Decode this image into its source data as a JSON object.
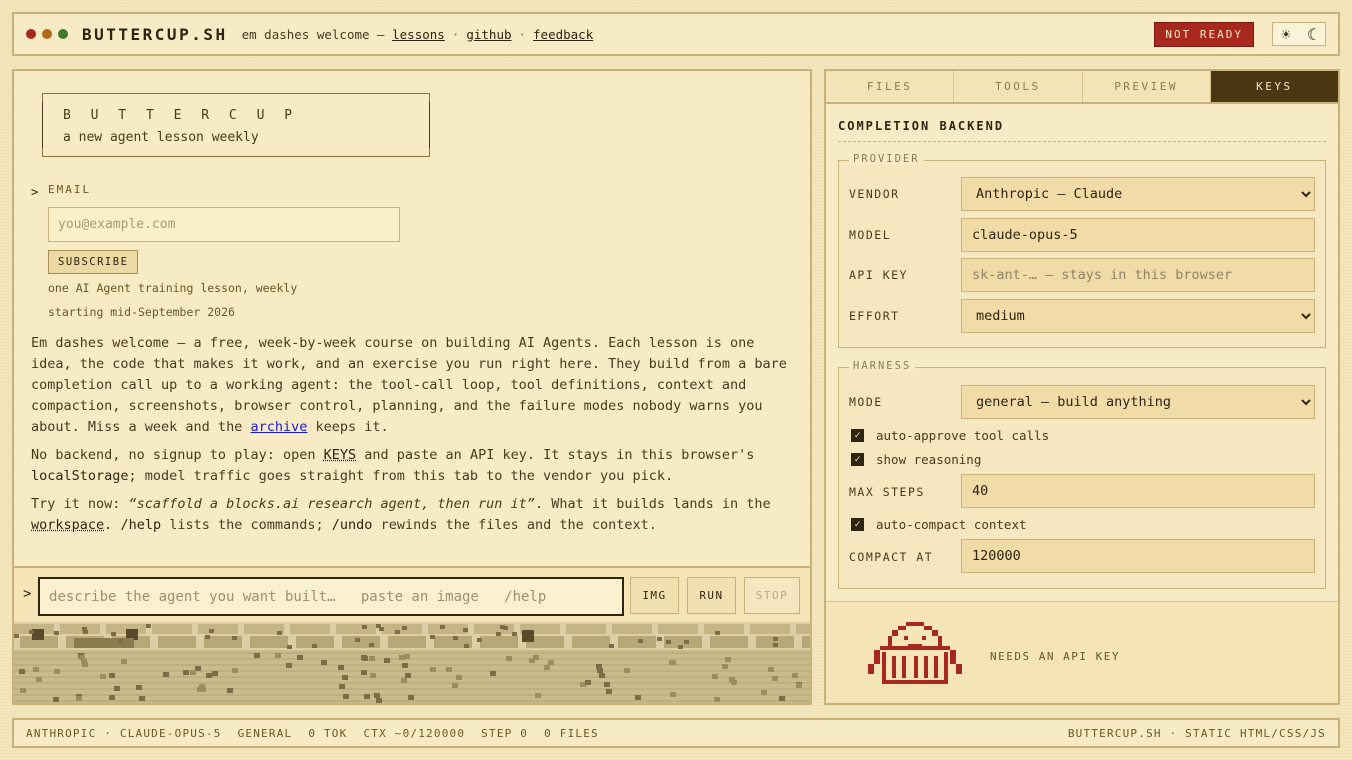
{
  "header": {
    "brand": "BUTTERCUP.SH",
    "tagline": "em dashes welcome —",
    "links": [
      "lessons",
      "github",
      "feedback"
    ],
    "status_badge": "NOT READY",
    "theme_sun_icon": "☀",
    "theme_moon_icon": "☾",
    "dot_colors": [
      "#a8281e",
      "#b06a17",
      "#3f7a2a"
    ]
  },
  "hero": {
    "title": "B U T T E R C U P",
    "subtitle": "a new agent lesson weekly"
  },
  "signup": {
    "caret": ">",
    "label": "EMAIL",
    "placeholder": "you@example.com",
    "button": "SUBSCRIBE",
    "note_1": "one AI Agent training lesson, weekly",
    "note_2": "starting mid-September 2026"
  },
  "intro": {
    "p1_text": "Em dashes welcome — a free, week-by-week course on building AI Agents. Each lesson is one idea, the code that makes it work, and an exercise you run right here. They build from a bare completion call up to a working agent: the tool-call loop, tool definitions, context and compaction, screenshots, browser control, planning, and the failure modes nobody warns you about. Miss a week and the",
    "p1_link": "archive",
    "p1_end": "keeps it.",
    "p2_start": "No backend, no signup to play: open",
    "p2_keys": "KEYS",
    "p2_mid": "and paste an API key. It stays in this browser's",
    "p2_code": "localStorage",
    "p2_end": "; model traffic goes straight from this tab to the vendor you pick.",
    "p3_start": "Try it now:",
    "p3_quote": "“scaffold a blocks.ai research agent, then run it”",
    "p3_mid": ". What it builds lands in the",
    "p3_workspace": "workspace",
    "p3_mid2": ".",
    "p3_help": "/help",
    "p3_mid3": "lists the commands;",
    "p3_undo": "/undo",
    "p3_end": "rewinds the files and the context."
  },
  "command": {
    "prompt": ">",
    "placeholder": "describe the agent you want built…   paste an image   /help",
    "img_button": "IMG",
    "run_button": "RUN",
    "stop_button": "STOP"
  },
  "side": {
    "tabs": [
      "FILES",
      "TOOLS",
      "PREVIEW",
      "KEYS"
    ],
    "active_tab": "KEYS",
    "section_title": "COMPLETION BACKEND",
    "provider": {
      "legend": "PROVIDER",
      "vendor_label": "VENDOR",
      "vendor_value": "Anthropic — Claude",
      "model_label": "MODEL",
      "model_value": "claude-opus-5",
      "api_key_label": "API KEY",
      "api_key_placeholder": "sk-ant-… — stays in this browser",
      "effort_label": "EFFORT",
      "effort_value": "medium"
    },
    "harness": {
      "legend": "HARNESS",
      "mode_label": "MODE",
      "mode_value": "general — build anything",
      "auto_approve": "auto-approve tool calls",
      "show_reasoning": "show reasoning",
      "max_steps_label": "MAX STEPS",
      "max_steps_value": "40",
      "auto_compact": "auto-compact context",
      "compact_at_label": "COMPACT AT",
      "compact_at_value": "120000"
    },
    "mascot_status": "NEEDS AN API KEY"
  },
  "footer": {
    "items": [
      "ANTHROPIC · CLAUDE-OPUS-5",
      "GENERAL",
      "0 TOK",
      "CTX ~0/120000",
      "STEP 0",
      "0 FILES"
    ],
    "right": "BUTTERCUP.SH · STATIC HTML/CSS/JS"
  },
  "colors": {
    "accent_red": "#a8281e",
    "ink": "#2e2410",
    "paper": "#f7ebc5",
    "tab_active": "#4a3612"
  }
}
